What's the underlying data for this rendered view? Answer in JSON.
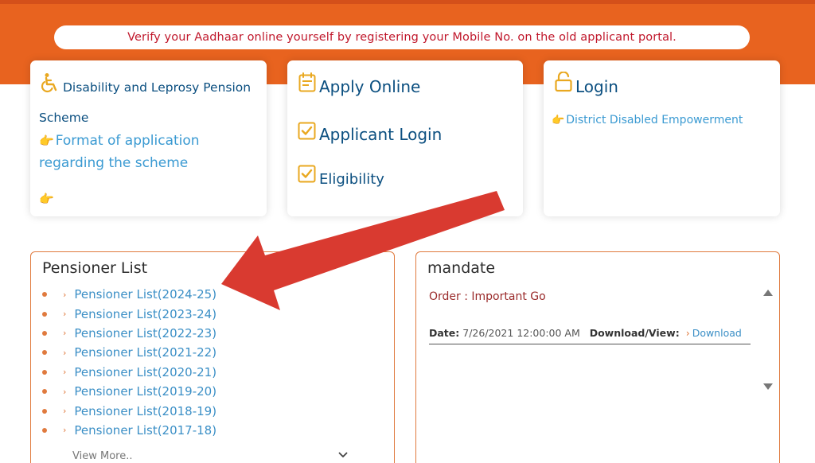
{
  "banner": {
    "notice": "Verify your Aadhaar online yourself by registering your Mobile No. on the old applicant portal."
  },
  "cards": {
    "scheme": {
      "title": "Disability and Leprosy Pension",
      "subtitle": "Scheme",
      "link_text_line1": "Format of application",
      "link_text_line2": "regarding the scheme"
    },
    "apply": {
      "apply_online": "Apply Online",
      "applicant_login": "Applicant Login",
      "eligibility": "Eligibility"
    },
    "login": {
      "title": "Login",
      "district_link": "District Disabled Empowerment"
    }
  },
  "pensioner_list": {
    "title": "Pensioner List",
    "items": [
      "Pensioner List(2024-25)",
      "Pensioner List(2023-24)",
      "Pensioner List(2022-23)",
      "Pensioner List(2021-22)",
      "Pensioner List(2020-21)",
      "Pensioner List(2019-20)",
      "Pensioner List(2018-19)",
      "Pensioner List(2017-18)"
    ],
    "view_more": "View More.."
  },
  "mandate": {
    "title": "mandate",
    "order": "Order : Important Go",
    "date_label": "Date:",
    "date_value": "7/26/2021 12:00:00 AM",
    "download_label": "Download/View:",
    "download_link": "Download"
  },
  "colors": {
    "header_orange": "#e8631f",
    "notice_red": "#c0172b",
    "title_blue": "#0b4f80",
    "link_blue": "#3a9ad2",
    "icon_gold": "#e9a820",
    "panel_border": "#e07a3e",
    "annotation_arrow": "#d93a30"
  },
  "icons": {
    "scheme": "wheelchair-icon",
    "apply_online": "form-icon",
    "applicant_login": "checkbox-icon",
    "eligibility": "checkbox-icon",
    "login": "unlock-icon",
    "link_pointer": "pointing-hand-icon"
  }
}
